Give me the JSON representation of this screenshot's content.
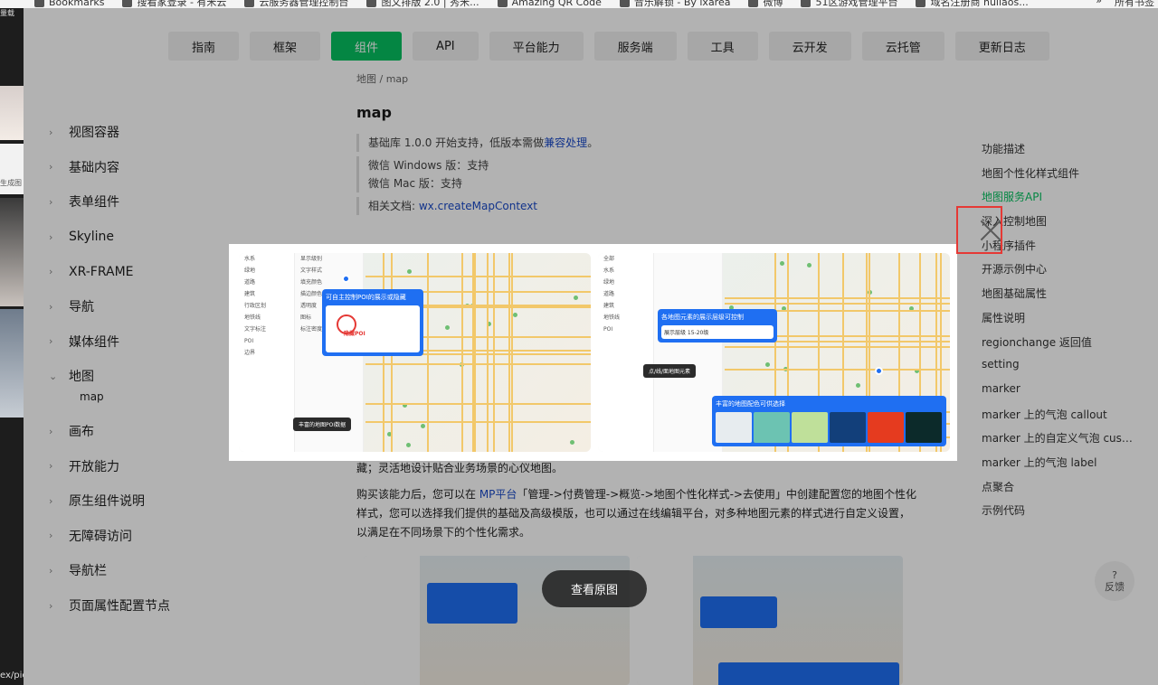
{
  "bookmarks": {
    "items": [
      "Bookmarks",
      "搜看家登录 - 有米云",
      "云服务器管理控制台",
      "图文排版 2.0 | 秀米...",
      "Amazing QR Code",
      "音乐解锁 - By ixarea",
      "微博",
      "51区游戏管理平台",
      "域名注册商 hullaos..."
    ],
    "overflow": "»",
    "all": "所有书签"
  },
  "strip": {
    "label_top": "量载",
    "label_mid": "生成图",
    "url_fragment": "ex/pic"
  },
  "topnav": {
    "items": [
      "指南",
      "框架",
      "组件",
      "API",
      "平台能力",
      "服务端",
      "工具",
      "云开发",
      "云托管",
      "更新日志"
    ],
    "active_index": 2
  },
  "sidebar": {
    "items": [
      "视图容器",
      "基础内容",
      "表单组件",
      "Skyline",
      "XR-FRAME",
      "导航",
      "媒体组件",
      "地图",
      "画布",
      "开放能力",
      "原生组件说明",
      "无障碍访问",
      "导航栏",
      "页面属性配置节点"
    ],
    "expanded_index": 7,
    "sub_item": "map"
  },
  "content": {
    "breadcrumb": "地图 / map",
    "title": "map",
    "note1_prefix": "基础库 1.0.0 开始支持，低版本需做",
    "note1_link": "兼容处理",
    "note1_suffix": "。",
    "note2_line1": "微信 Windows 版：支持",
    "note2_line2": "微信 Mac 版：支持",
    "note3_prefix": "相关文档: ",
    "note3_link": "wx.createMapContext",
    "para1": "藏；灵活地设计贴合业务场景的心仪地图。",
    "para2_prefix": "购买该能力后，您可以在 ",
    "para2_link": "MP平台",
    "para2_suffix": "「管理->付费管理->概览->地图个性化样式->去使用」中创建配置您的地图个性化样式，您可以选择我们提供的基础及高级模版，也可以通过在线编辑平台，对多种地图元素的样式进行自定义设置，以满足在不同场景下的个性化需求。"
  },
  "toc": {
    "items": [
      "功能描述",
      "地图个性化样式组件",
      "地图服务API",
      "深入控制地图",
      "小程序插件",
      "开源示例中心",
      "地图基础属性",
      "属性说明",
      "regionchange 返回值",
      "setting",
      "marker",
      "marker 上的气泡 callout",
      "marker 上的自定义气泡 custom callout",
      "marker 上的气泡 label",
      "点聚合",
      "示例代码"
    ],
    "active_index": 2
  },
  "feedback": {
    "icon": "?",
    "label": "反馈"
  },
  "viewer": {
    "left_panel": {
      "sidebar_rows": [
        "水系",
        "绿地",
        "道路",
        "建筑",
        "行政区划",
        "地铁线",
        "文字标注",
        "POI",
        "边界"
      ],
      "settings_rows": [
        "显示级别",
        "文字样式",
        "填充颜色",
        "描边颜色",
        "透明度",
        "图标",
        "标注密度"
      ],
      "callout_title": "可自主控制POI的展示或隐藏",
      "callout_badge": "隐藏POI",
      "pill": "丰富的地图POI数据"
    },
    "right_panel": {
      "sidebar_rows": [
        "全部",
        "水系",
        "绿地",
        "道路",
        "建筑",
        "地铁线",
        "POI"
      ],
      "callout_title": "各地图元素的展示层级可控制",
      "callout_range": "展示层级   15-20级",
      "pill": "点/线/面地图元素",
      "bottom_title": "丰富的地图配色可供选择",
      "swatch_colors": [
        "#e7ecef",
        "#6cc3b2",
        "#bfe09a",
        "#123f7a",
        "#e53b1f",
        "#0c2a2a"
      ]
    },
    "accent": "#1f6ff2"
  },
  "view_original": "查看原图",
  "colors": {
    "brand": "#07c160",
    "link": "#1a4ac8",
    "highlight": "#e53935"
  }
}
